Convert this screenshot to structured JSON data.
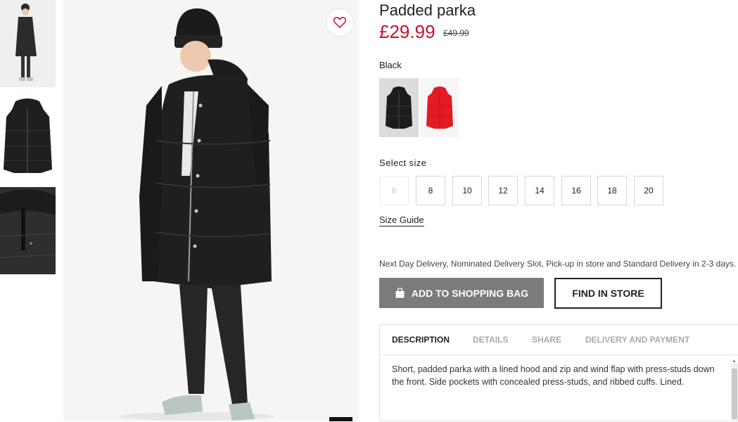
{
  "product": {
    "title": "Padded parka",
    "price": "£29.99",
    "old_price": "£49.99",
    "color_label": "Black"
  },
  "swatches": [
    {
      "name": "Black",
      "color": "#1c1c1c",
      "selected": true
    },
    {
      "name": "Red",
      "color": "#e31b23",
      "selected": false
    }
  ],
  "sizes": {
    "label": "Select size",
    "options": [
      {
        "value": "6",
        "available": false
      },
      {
        "value": "8",
        "available": true
      },
      {
        "value": "10",
        "available": true
      },
      {
        "value": "12",
        "available": true
      },
      {
        "value": "14",
        "available": true
      },
      {
        "value": "16",
        "available": true
      },
      {
        "value": "18",
        "available": true
      },
      {
        "value": "20",
        "available": true
      }
    ],
    "guide_label": "Size Guide"
  },
  "delivery": {
    "text": "Next Day Delivery, Nominated Delivery Slot, Pick-up in store and Standard Delivery in 2-3 days."
  },
  "actions": {
    "add_to_bag": "ADD TO SHOPPING BAG",
    "find_in_store": "FIND IN STORE"
  },
  "tabs": [
    {
      "label": "DESCRIPTION",
      "active": true
    },
    {
      "label": "DETAILS",
      "active": false
    },
    {
      "label": "SHARE",
      "active": false
    },
    {
      "label": "DELIVERY AND PAYMENT",
      "active": false
    }
  ],
  "description": "Short, padded parka with a lined hood and zip and wind flap with press-studs down the front. Side pockets with concealed press-studs, and ribbed cuffs. Lined.",
  "colors": {
    "price": "#c8102e",
    "add_button": "#7b7b7b",
    "favorite_heart": "#c8102e"
  },
  "icons": {
    "favorite": "heart-icon",
    "bag": "shopping-bag-icon"
  }
}
